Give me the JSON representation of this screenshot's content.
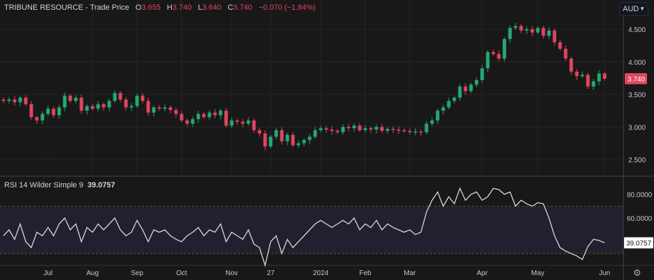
{
  "header": {
    "title": "TRIBUNE RESOURCE - Trade Price",
    "o_label": "O",
    "o": "3.655",
    "h_label": "H",
    "h": "3.740",
    "l_label": "L",
    "l": "3.640",
    "c_label": "C",
    "c": "3.740",
    "change": "−0.070 (−1.84%)"
  },
  "currency": "AUD",
  "rsi_legend": {
    "label": "RSI 14 Wilder Simple 9",
    "value": "39.0757"
  },
  "colors": {
    "up": "#26a875",
    "down": "#e0455e",
    "bg": "#181818",
    "rsi": "#d8d8d8",
    "band": "#241f2e"
  },
  "chart_data": [
    {
      "type": "candlestick",
      "title": "TRIBUNE RESOURCE - Trade Price",
      "ylim": [
        2.3,
        4.75
      ],
      "yticks": [
        "4.500",
        "4.000",
        "3.500",
        "3.000",
        "2.500"
      ],
      "ytick_values": [
        4.5,
        4.0,
        3.5,
        3.0,
        2.5
      ],
      "last_price": "3.740",
      "xticks": [
        "Jul",
        "Aug",
        "Sep",
        "Oct",
        "Nov",
        "27",
        "2024",
        "Feb",
        "Mar",
        "Apr",
        "May",
        "Jun"
      ],
      "xtick_index": [
        8,
        16,
        24,
        32,
        41,
        48,
        57,
        65,
        73,
        86,
        96,
        108
      ],
      "closes": [
        3.4,
        3.42,
        3.38,
        3.45,
        3.35,
        3.15,
        3.1,
        3.2,
        3.28,
        3.18,
        3.3,
        3.48,
        3.4,
        3.45,
        3.25,
        3.32,
        3.28,
        3.35,
        3.3,
        3.4,
        3.52,
        3.42,
        3.3,
        3.32,
        3.48,
        3.4,
        3.22,
        3.3,
        3.28,
        3.3,
        3.26,
        3.2,
        3.1,
        3.05,
        3.12,
        3.2,
        3.15,
        3.22,
        3.18,
        3.25,
        3.02,
        3.1,
        3.08,
        3.05,
        3.1,
        2.95,
        2.9,
        2.7,
        2.85,
        2.95,
        2.78,
        2.88,
        2.72,
        2.75,
        2.8,
        2.85,
        2.95,
        2.98,
        2.96,
        2.94,
        2.92,
        3.0,
        2.98,
        3.02,
        2.95,
        2.98,
        2.96,
        3.0,
        2.94,
        2.97,
        2.96,
        2.95,
        2.94,
        2.92,
        2.93,
        2.92,
        3.05,
        3.1,
        3.25,
        3.3,
        3.4,
        3.45,
        3.62,
        3.55,
        3.65,
        3.72,
        3.9,
        4.15,
        4.12,
        4.05,
        4.35,
        4.52,
        4.55,
        4.48,
        4.5,
        4.45,
        4.52,
        4.4,
        4.48,
        4.3,
        4.2,
        4.05,
        3.85,
        3.78,
        3.8,
        3.62,
        3.7,
        3.82,
        3.74
      ]
    },
    {
      "type": "line",
      "title": "RSI 14 Wilder Simple 9",
      "ylim": [
        25,
        90
      ],
      "yticks": [
        "80.0000",
        "60.0000"
      ],
      "ytick_values": [
        80,
        60
      ],
      "band": [
        30,
        70
      ],
      "last_value": "39.0757",
      "values": [
        45,
        50,
        42,
        55,
        40,
        35,
        48,
        45,
        52,
        45,
        55,
        60,
        50,
        55,
        40,
        52,
        48,
        55,
        50,
        55,
        60,
        50,
        45,
        48,
        58,
        50,
        40,
        50,
        48,
        50,
        45,
        42,
        40,
        45,
        48,
        52,
        45,
        50,
        48,
        55,
        40,
        48,
        45,
        42,
        50,
        38,
        35,
        20,
        40,
        45,
        30,
        42,
        35,
        40,
        45,
        50,
        55,
        58,
        55,
        52,
        55,
        58,
        55,
        60,
        50,
        55,
        52,
        58,
        50,
        55,
        52,
        50,
        48,
        50,
        46,
        48,
        65,
        75,
        82,
        70,
        78,
        72,
        85,
        75,
        80,
        82,
        75,
        78,
        85,
        84,
        80,
        82,
        70,
        75,
        72,
        70,
        73,
        72,
        60,
        45,
        35,
        32,
        30,
        28,
        25,
        36,
        42,
        41,
        39.08
      ]
    }
  ]
}
